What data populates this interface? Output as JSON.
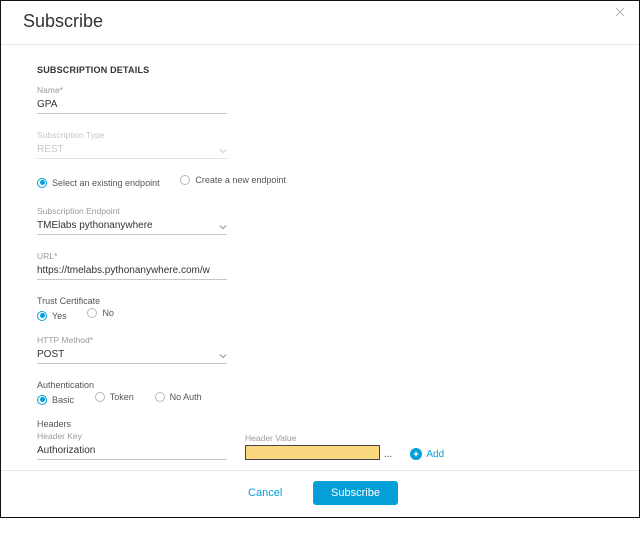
{
  "title": "Subscribe",
  "section_details": "SUBSCRIPTION DETAILS",
  "name": {
    "label": "Name*",
    "value": "GPA"
  },
  "sub_type": {
    "label": "Subscription Type",
    "value": "REST"
  },
  "endpoint_mode": {
    "existing": "Select an existing endpoint",
    "create": "Create a new endpoint",
    "selected": "existing"
  },
  "endpoint": {
    "label": "Subscription Endpoint",
    "value": "TMElabs pythonanywhere"
  },
  "url": {
    "label": "URL*",
    "value": "https://tmelabs.pythonanywhere.com/w"
  },
  "trust": {
    "label": "Trust Certificate",
    "yes": "Yes",
    "no": "No",
    "selected": "yes"
  },
  "http_method": {
    "label": "HTTP Method*",
    "value": "POST"
  },
  "auth": {
    "label": "Authentication",
    "basic": "Basic",
    "token": "Token",
    "noauth": "No Auth",
    "selected": "basic"
  },
  "headers": {
    "label": "Headers",
    "key_label": "Header Key",
    "value_label": "Header Value",
    "key_value": "Authorization",
    "value_value": "",
    "add": "Add"
  },
  "footer": {
    "cancel": "Cancel",
    "subscribe": "Subscribe"
  }
}
